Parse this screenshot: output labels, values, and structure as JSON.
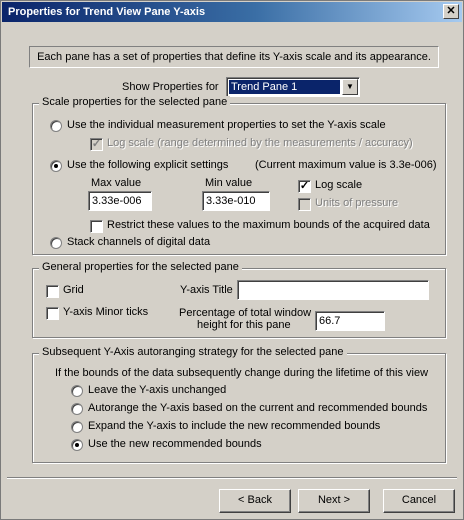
{
  "window": {
    "title": "Properties for Trend View Pane Y-axis"
  },
  "info_text": "Each pane has a set of properties that define its Y-axis scale and its appearance.",
  "show_properties": {
    "label": "Show Properties for",
    "selected": "Trend Pane 1"
  },
  "scale_group": {
    "label": "Scale properties for the selected pane",
    "individual_option": "Use the individual measurement properties to set the Y-axis scale",
    "log_scale_range": "Log scale (range determined by the measurements / accuracy)",
    "explicit_option": "Use the following explicit settings",
    "current_max": "(Current maximum value is 3.3e-006)",
    "max_label": "Max value",
    "max_value": "3.33e-006",
    "min_label": "Min value",
    "min_value": "3.33e-010",
    "log_scale": "Log scale",
    "units_pressure": "Units of pressure",
    "restrict": "Restrict these values to the maximum bounds of the acquired data",
    "stack_option": "Stack channels of digital data"
  },
  "general_group": {
    "label": "General properties for the selected pane",
    "grid": "Grid",
    "yaxis_title_label": "Y-axis Title",
    "yaxis_title_value": "",
    "minor_ticks": "Y-axis Minor ticks",
    "pct_line1": "Percentage of total window",
    "pct_line2": "height for this pane",
    "pct_value": "66.7"
  },
  "autorange_group": {
    "label": "Subsequent Y-Axis autoranging strategy for the selected pane",
    "intro": "If the bounds of the data subsequently change during the lifetime of this view",
    "options": [
      "Leave the Y-axis unchanged",
      "Autorange the Y-axis based on the current and recommended bounds",
      "Expand the Y-axis to include the new recommended bounds",
      "Use the new recommended bounds"
    ]
  },
  "buttons": {
    "back": "< Back",
    "next": "Next >",
    "cancel": "Cancel"
  }
}
